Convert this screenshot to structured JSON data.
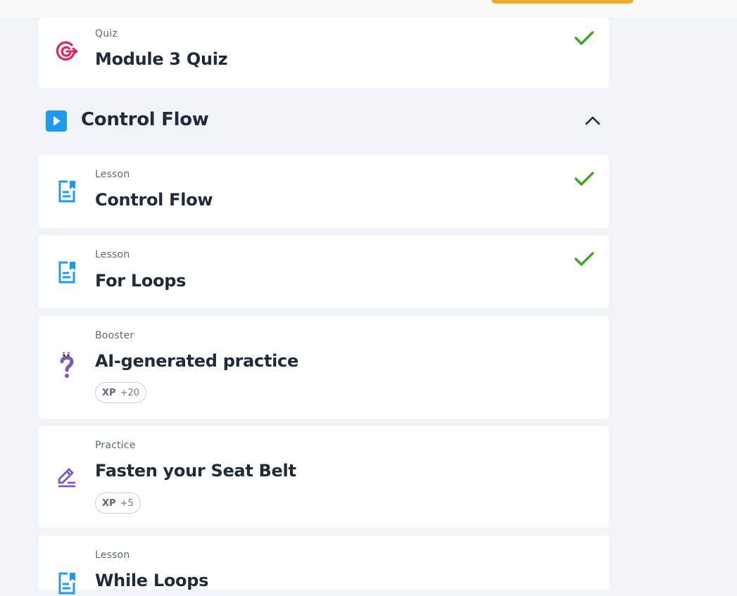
{
  "section": {
    "title": "Control Flow"
  },
  "items": [
    {
      "type": "Quiz",
      "title": "Module 3 Quiz",
      "icon": "target-icon",
      "completed": true
    },
    {
      "type": "Lesson",
      "title": "Control Flow",
      "icon": "lesson-doc-icon",
      "completed": true
    },
    {
      "type": "Lesson",
      "title": "For Loops",
      "icon": "lesson-doc-icon",
      "completed": true
    },
    {
      "type": "Booster",
      "title": "AI-generated practice",
      "icon": "question-mark-icon",
      "completed": false,
      "xp_label": "XP",
      "xp_value": "+20"
    },
    {
      "type": "Practice",
      "title": "Fasten your Seat Belt",
      "icon": "pencil-icon",
      "completed": false,
      "xp_label": "XP",
      "xp_value": "+5"
    },
    {
      "type": "Lesson",
      "title": "While Loops",
      "icon": "lesson-doc-icon",
      "completed": false
    }
  ],
  "colors": {
    "accent": "#1d9bf0",
    "check": "#3aaa1e",
    "quiz": "#e0245e",
    "practice": "#7e57c2",
    "topbar_button": "#f5a623"
  }
}
